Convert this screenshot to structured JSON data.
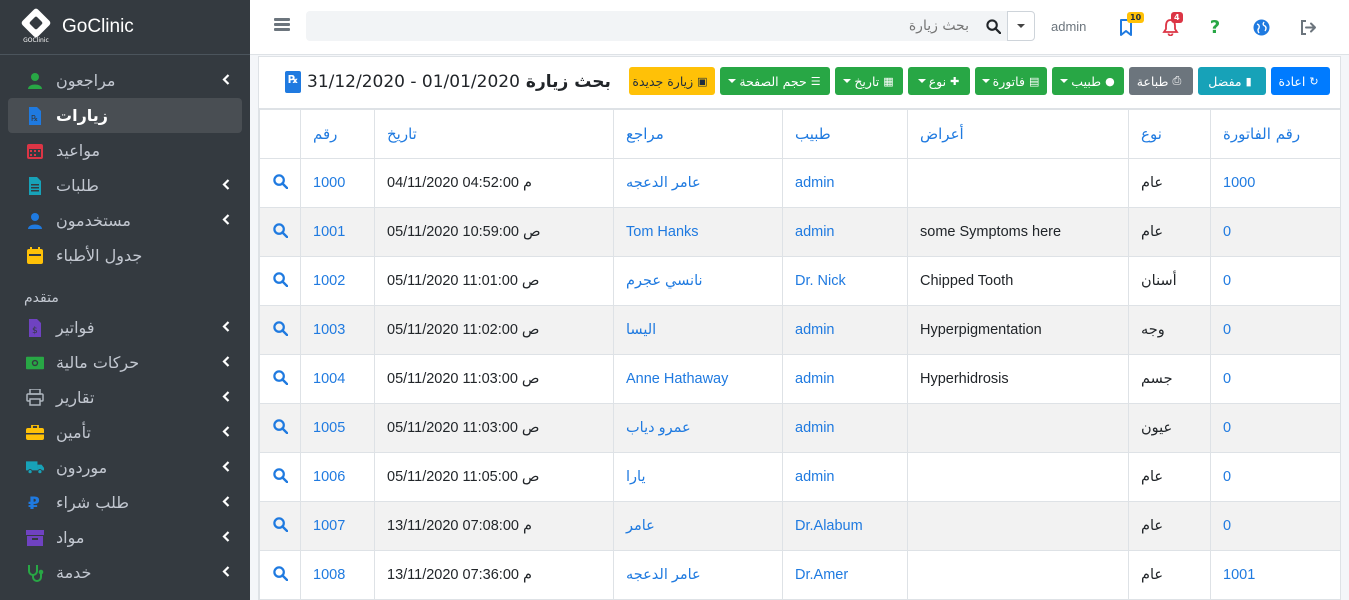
{
  "app": {
    "name": "GoClinic",
    "logo_sub": "GOClinic"
  },
  "sidebar": {
    "items": [
      {
        "label": "مراجعون",
        "icon": "user-icon",
        "color": "#28a745",
        "chevron": true,
        "active": false
      },
      {
        "label": "زيارات",
        "icon": "prescription-icon",
        "color": "#1f7ae0",
        "chevron": false,
        "active": true
      },
      {
        "label": "مواعيد",
        "icon": "calendar-icon",
        "color": "#dc3545",
        "chevron": false,
        "active": false
      },
      {
        "label": "طلبات",
        "icon": "file-icon",
        "color": "#17a2b8",
        "chevron": true,
        "active": false
      },
      {
        "label": "مستخدمون",
        "icon": "users-icon",
        "color": "#1f7ae0",
        "chevron": true,
        "active": false
      },
      {
        "label": "جدول الأطباء",
        "icon": "calendar-schedule-icon",
        "color": "#ffc107",
        "chevron": false,
        "active": false
      }
    ],
    "advanced_header": "متقدم",
    "advanced_items": [
      {
        "label": "فواتير",
        "icon": "invoice-icon",
        "color": "#6f42c1",
        "chevron": true
      },
      {
        "label": "حركات مالية",
        "icon": "money-icon",
        "color": "#28a745",
        "chevron": true
      },
      {
        "label": "تقارير",
        "icon": "print-icon",
        "color": "#adb5bd",
        "chevron": true
      },
      {
        "label": "تأمين",
        "icon": "briefcase-icon",
        "color": "#ffc107",
        "chevron": true
      },
      {
        "label": "موردون",
        "icon": "truck-icon",
        "color": "#17a2b8",
        "chevron": true
      },
      {
        "label": "طلب شراء",
        "icon": "ruble-icon",
        "color": "#1f7ae0",
        "chevron": true
      },
      {
        "label": "مواد",
        "icon": "archive-icon",
        "color": "#6f42c1",
        "chevron": true
      },
      {
        "label": "خدمة",
        "icon": "stethoscope-icon",
        "color": "#28a745",
        "chevron": true
      }
    ]
  },
  "topbar": {
    "search_placeholder": "بحث زيارة",
    "user": "admin",
    "flag_badge": "10",
    "bell_badge": "4"
  },
  "header": {
    "title_prefix": "بحث زيارة",
    "date_range": "31/12/2020 - 01/01/2020",
    "buttons": {
      "new_visit": "زيارة جديدة",
      "page_size": "حجم الصفحة",
      "date": "تاريخ",
      "type": "نوع",
      "invoice": "فاتورة",
      "doctor": "طبيب",
      "print": "طباعة",
      "favorite": "مفضل",
      "reset": "اعادة"
    }
  },
  "table": {
    "columns": [
      "",
      "رقم",
      "تاريخ",
      "مراجع",
      "طبيب",
      "أعراض",
      "نوع",
      "رقم الفاتورة"
    ],
    "rows": [
      {
        "id": "1000",
        "date": "04/11/2020 04:52:00 م",
        "patient": "عامر الدعجه",
        "doctor": "admin",
        "symptoms": "",
        "type": "عام",
        "invoice": "1000"
      },
      {
        "id": "1001",
        "date": "05/11/2020 10:59:00 ص",
        "patient": "Tom Hanks",
        "doctor": "admin",
        "symptoms": "some Symptoms here",
        "type": "عام",
        "invoice": "0"
      },
      {
        "id": "1002",
        "date": "05/11/2020 11:01:00 ص",
        "patient": "نانسي عجرم",
        "doctor": "Dr. Nick",
        "symptoms": "Chipped Tooth",
        "type": "أسنان",
        "invoice": "0"
      },
      {
        "id": "1003",
        "date": "05/11/2020 11:02:00 ص",
        "patient": "اليسا",
        "doctor": "admin",
        "symptoms": "Hyperpigmentation",
        "type": "وجه",
        "invoice": "0"
      },
      {
        "id": "1004",
        "date": "05/11/2020 11:03:00 ص",
        "patient": "Anne Hathaway",
        "doctor": "admin",
        "symptoms": "Hyperhidrosis",
        "type": "جسم",
        "invoice": "0"
      },
      {
        "id": "1005",
        "date": "05/11/2020 11:03:00 ص",
        "patient": "عمرو دياب",
        "doctor": "admin",
        "symptoms": "",
        "type": "عيون",
        "invoice": "0"
      },
      {
        "id": "1006",
        "date": "05/11/2020 11:05:00 ص",
        "patient": "يارا",
        "doctor": "admin",
        "symptoms": "",
        "type": "عام",
        "invoice": "0"
      },
      {
        "id": "1007",
        "date": "13/11/2020 07:08:00 م",
        "patient": "عامر",
        "doctor": "Dr.Alabum",
        "symptoms": "",
        "type": "عام",
        "invoice": "0"
      },
      {
        "id": "1008",
        "date": "13/11/2020 07:36:00 م",
        "patient": "عامر الدعجه",
        "doctor": "Dr.Amer",
        "symptoms": "",
        "type": "عام",
        "invoice": "1001"
      }
    ]
  },
  "colors": {
    "sidebar_bg": "#343a40",
    "accent": "#1f7ae0",
    "success": "#28a745",
    "warning": "#ffc107"
  }
}
